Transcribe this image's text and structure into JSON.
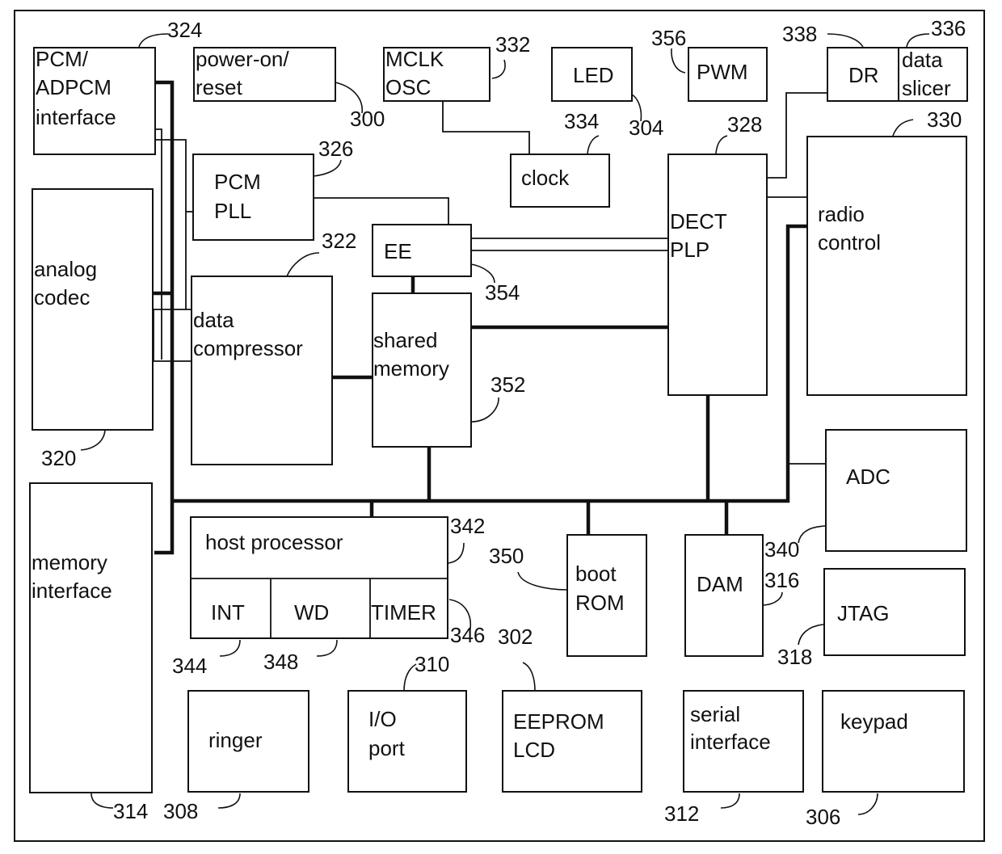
{
  "diagram": {
    "type": "block-diagram",
    "blocks": {
      "pcm_adpcm": {
        "lines": [
          "PCM/",
          "ADPCM",
          "interface"
        ],
        "ref": "324"
      },
      "power_on": {
        "lines": [
          "power-on/",
          "reset"
        ],
        "ref": "300"
      },
      "mclk": {
        "lines": [
          "MCLK",
          "OSC"
        ],
        "ref": "332"
      },
      "led": {
        "lines": [
          "LED"
        ],
        "ref": "304"
      },
      "pwm": {
        "lines": [
          "PWM"
        ],
        "ref": "356"
      },
      "dr": {
        "lines": [
          "DR"
        ],
        "ref": "338"
      },
      "slicer": {
        "lines": [
          "data",
          "slicer"
        ],
        "ref": "336"
      },
      "clock": {
        "lines": [
          "clock"
        ],
        "ref": "334"
      },
      "pcm_pll": {
        "lines": [
          "PCM",
          "PLL"
        ],
        "ref": "326"
      },
      "dect": {
        "lines": [
          "DECT",
          "PLP"
        ],
        "ref": "328"
      },
      "radio": {
        "lines": [
          "radio",
          "control"
        ],
        "ref": "330"
      },
      "analog": {
        "lines": [
          "analog",
          "codec"
        ],
        "ref": "320"
      },
      "ee": {
        "lines": [
          "EE"
        ],
        "ref": "354"
      },
      "compressor": {
        "lines": [
          "data",
          "compressor"
        ],
        "ref": "322"
      },
      "shared": {
        "lines": [
          "shared",
          "memory"
        ],
        "ref": "352"
      },
      "adc": {
        "lines": [
          "ADC"
        ],
        "ref": "340"
      },
      "meminterface": {
        "lines": [
          "memory",
          "interface"
        ],
        "ref": "314"
      },
      "host": {
        "lines": [
          "host processor"
        ],
        "ref": "342"
      },
      "int": {
        "lines": [
          "INT"
        ],
        "ref": "344"
      },
      "wd": {
        "lines": [
          "WD"
        ],
        "ref": "348"
      },
      "timer": {
        "lines": [
          "TIMER"
        ],
        "ref": "346"
      },
      "bootrom": {
        "lines": [
          "boot",
          "ROM"
        ],
        "ref": "350"
      },
      "dam": {
        "lines": [
          "DAM"
        ],
        "ref": "316"
      },
      "jtag": {
        "lines": [
          "JTAG"
        ],
        "ref": "318"
      },
      "ringer": {
        "lines": [
          "ringer"
        ],
        "ref": "308"
      },
      "io": {
        "lines": [
          "I/O",
          "port"
        ],
        "ref": "310"
      },
      "eeprom": {
        "lines": [
          "EEPROM",
          "LCD"
        ],
        "ref": "302"
      },
      "serial": {
        "lines": [
          "serial",
          "interface"
        ],
        "ref": "312"
      },
      "keypad": {
        "lines": [
          "keypad"
        ],
        "ref": "306"
      }
    },
    "connections": [
      [
        "pcm_adpcm",
        "system-bus"
      ],
      [
        "analog",
        "system-bus"
      ],
      [
        "meminterface",
        "system-bus"
      ],
      [
        "pcm_adpcm",
        "pcm_pll"
      ],
      [
        "pcm_adpcm",
        "compressor"
      ],
      [
        "analog",
        "compressor"
      ],
      [
        "mclk",
        "clock"
      ],
      [
        "pcm_pll",
        "dect"
      ],
      [
        "ee",
        "dect"
      ],
      [
        "ee",
        "shared"
      ],
      [
        "compressor",
        "shared"
      ],
      [
        "shared",
        "dect"
      ],
      [
        "shared",
        "system-bus"
      ],
      [
        "dect",
        "system-bus"
      ],
      [
        "dect",
        "dr"
      ],
      [
        "dect",
        "radio"
      ],
      [
        "radio",
        "system-bus"
      ],
      [
        "adc",
        "system-bus"
      ],
      [
        "host",
        "system-bus"
      ],
      [
        "bootrom",
        "system-bus"
      ],
      [
        "dam",
        "system-bus"
      ]
    ]
  }
}
